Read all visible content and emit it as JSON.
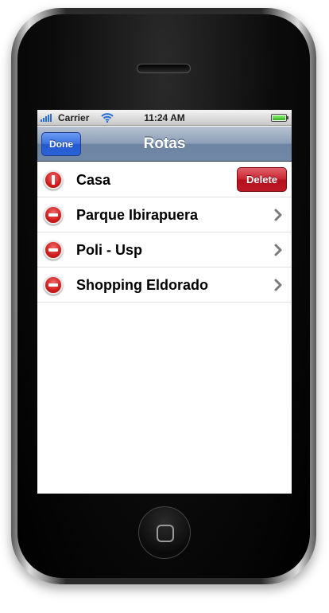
{
  "status_bar": {
    "carrier": "Carrier",
    "time": "11:24 AM",
    "signal_icon": "signal-bars-icon",
    "wifi_icon": "wifi-icon",
    "battery_icon": "battery-icon",
    "battery_level": 1.0
  },
  "nav": {
    "title": "Rotas",
    "done_label": "Done"
  },
  "rows": [
    {
      "label": "Casa",
      "state": "delete-confirm",
      "action_label": "Delete"
    },
    {
      "label": "Parque Ibirapuera",
      "state": "editing"
    },
    {
      "label": "Poli - Usp",
      "state": "editing"
    },
    {
      "label": "Shopping Eldorado",
      "state": "editing"
    }
  ],
  "colors": {
    "nav_bar": "#7088a6",
    "done_button": "#2c62d8",
    "delete_button": "#be1826",
    "delete_badge": "#d11b1b"
  }
}
